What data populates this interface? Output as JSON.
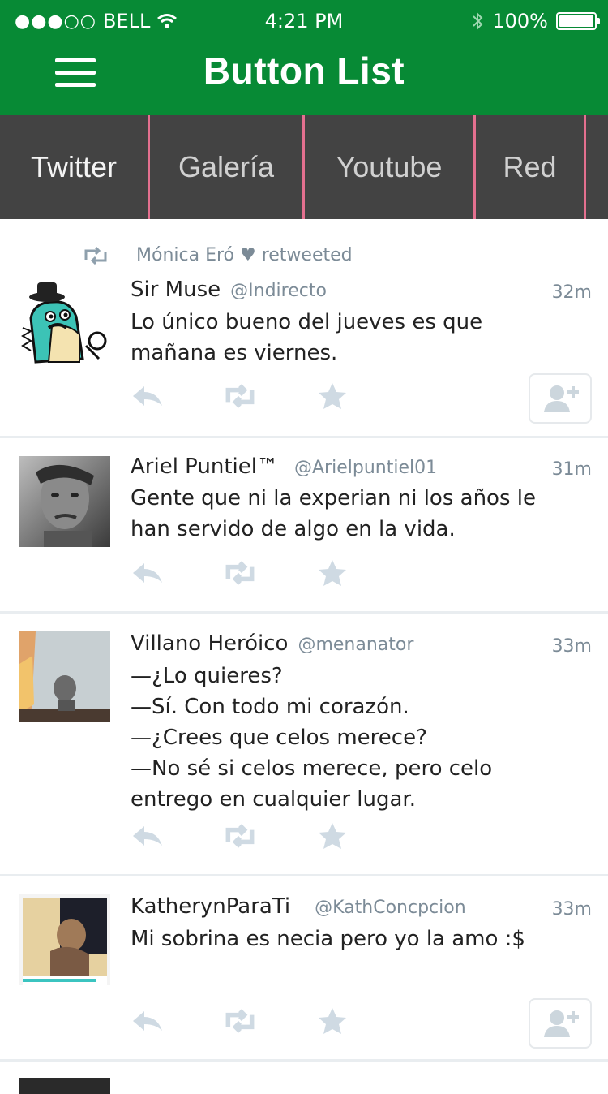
{
  "status": {
    "carrier": "BELL",
    "signal_dots": "●●●○○",
    "time": "4:21 PM",
    "battery": "100%"
  },
  "header": {
    "title": "Button List"
  },
  "tabs": [
    {
      "label": "Twitter"
    },
    {
      "label": "Galería"
    },
    {
      "label": "Youtube"
    },
    {
      "label": "Red"
    }
  ],
  "tweets": [
    {
      "retweeted_by": "Mónica Eró ♥ retweeted",
      "name": "Sir Muse",
      "handle": "@Indirecto",
      "time": "32m",
      "text": "Lo único bueno del jueves es que\nmañana es viernes."
    },
    {
      "name": "Ariel Puntiel™",
      "handle": "@Arielpuntiel01",
      "time": "31m",
      "text": "Gente que ni la experian ni los años le\nhan servido de algo en la vida."
    },
    {
      "name": "Villano Heróico",
      "handle": "@menanator",
      "time": "33m",
      "text": "—¿Lo quieres?\n—Sí. Con todo mi corazón.\n—¿Crees que celos merece?\n—No sé si celos merece, pero celo\nentrego en cualquier lugar."
    },
    {
      "name": "KatherynParaTi",
      "handle": "@KathConcpcion",
      "time": "33m",
      "text": "Mi sobrina es necia pero yo la amo :$"
    }
  ],
  "colors": {
    "header": "#078a35",
    "tabs_bg": "#434343",
    "tab_divider": "#e4708f",
    "meta": "#7c8b97",
    "action_icon": "#cfdae3"
  },
  "icons": {
    "menu": "hamburger-icon",
    "retweet": "retweet-icon",
    "reply": "reply-icon",
    "favorite": "star-icon",
    "follow": "add-user-icon"
  }
}
